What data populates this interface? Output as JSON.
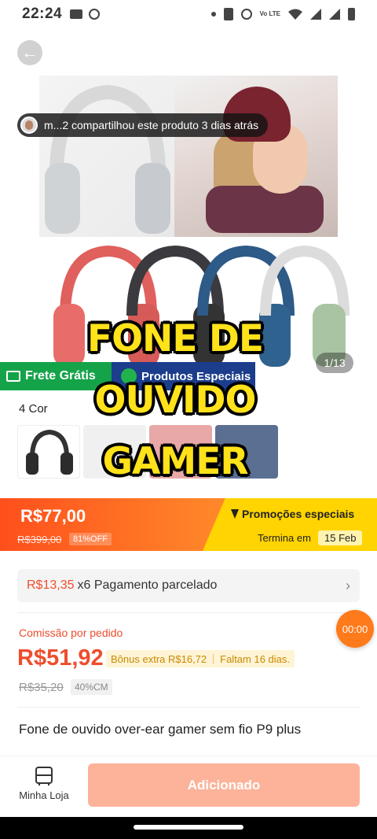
{
  "status_bar": {
    "time": "22:24",
    "icons": [
      "video-icon",
      "android-icon",
      "dot-icon",
      "vibrate-icon",
      "dnd-icon",
      "volte-icon",
      "wifi-icon",
      "signal-icon",
      "signal-icon",
      "battery-icon"
    ],
    "lte_label": "Vo LTE"
  },
  "gallery": {
    "share_text": "m...2 compartilhou este produto 3 dias atrás",
    "counter": "1/13",
    "free_shipping": "Frete Grátis",
    "special_products": "Produtos Especiais"
  },
  "overlay_text": [
    "FONE DE",
    "OUVIDO",
    "GAMER"
  ],
  "colors_label": "4 Cor",
  "price_bar": {
    "price": "R$77,00",
    "old_price": "R$399,00",
    "discount": "81%OFF",
    "promo_title": "Promoções especiais",
    "ends_label": "Termina em",
    "ends_date": "15 Feb"
  },
  "installment": {
    "amount": "R$13,35",
    "text": "x6 Pagamento parcelado"
  },
  "commission": {
    "label": "Comissão por pedido",
    "price": "R$51,92",
    "bonus": "Bônus extra R$16,72",
    "remaining": "Faltam 16 dias.",
    "old_price": "R$35,20",
    "cm_badge": "40%CM"
  },
  "timer": "00:00",
  "product_title": "Fone de ouvido over-ear gamer sem fio P9 plus",
  "bottom_bar": {
    "store_label": "Minha Loja",
    "add_button": "Adicionado"
  },
  "accent_colors": {
    "orange": "#ee4d2d",
    "yellow": "#ffd400",
    "green": "#15a349",
    "blue": "#1c3d8c"
  }
}
